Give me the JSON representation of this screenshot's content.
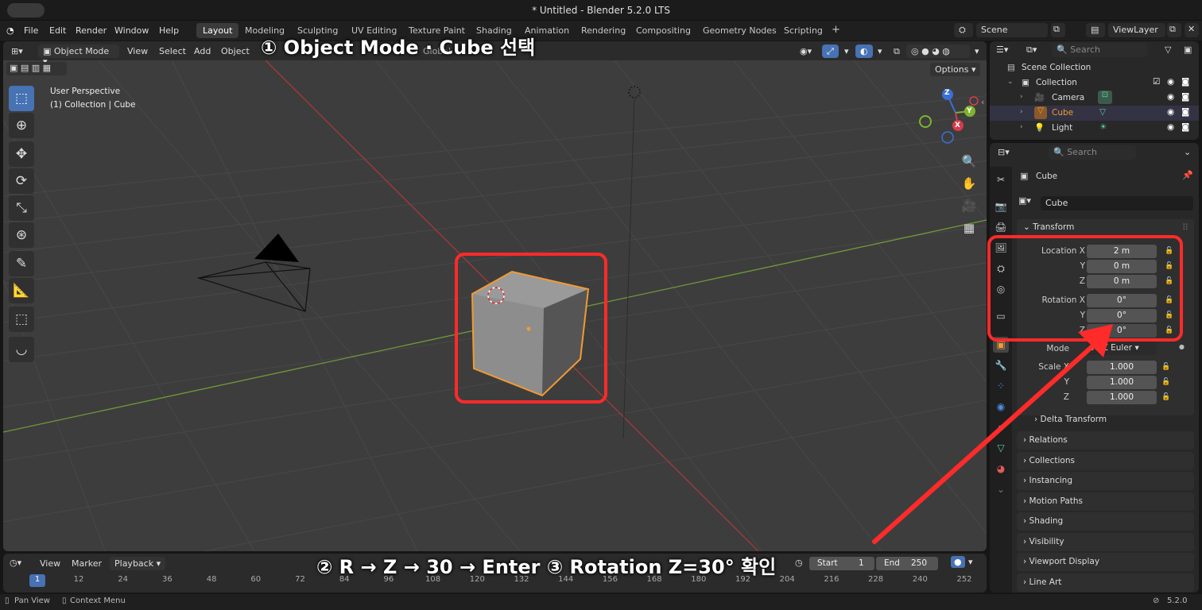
{
  "window": {
    "title": "* Untitled - Blender 5.2.0 LTS"
  },
  "menu": {
    "items": [
      "File",
      "Edit",
      "Render",
      "Window",
      "Help"
    ]
  },
  "workspaces": {
    "tabs": [
      "Layout",
      "Modeling",
      "Sculpting",
      "UV Editing",
      "Texture Paint",
      "Shading",
      "Animation",
      "Rendering",
      "Compositing",
      "Geometry Nodes",
      "Scripting"
    ],
    "active": "Layout",
    "add": "+"
  },
  "scene": {
    "name": "Scene",
    "view_layer": "ViewLayer"
  },
  "viewport": {
    "mode": "Object Mode",
    "menu": [
      "View",
      "Select",
      "Add",
      "Object"
    ],
    "orientation": "Global",
    "options_label": "Options",
    "overlay_line1": "User Perspective",
    "overlay_line2": "(1) Collection | Cube",
    "gizmo": {
      "x": "X",
      "y": "Y",
      "z": "Z"
    }
  },
  "outliner": {
    "search_placeholder": "Search",
    "root": "Scene Collection",
    "collection": "Collection",
    "items": [
      "Camera",
      "Cube",
      "Light"
    ]
  },
  "properties": {
    "search_placeholder": "Search",
    "object_name": "Cube",
    "object_field": "Cube",
    "transform_header": "Transform",
    "location_label": "Location X",
    "rotation_label": "Rotation X",
    "y_label": "Y",
    "z_label": "Z",
    "location": [
      "2 m",
      "0 m",
      "0 m"
    ],
    "rotation": [
      "0°",
      "0°",
      "0°"
    ],
    "mode_label": "Mode",
    "mode_value": "XYZ Euler",
    "scale_label": "Scale X",
    "scale": [
      "1.000",
      "1.000",
      "1.000"
    ],
    "delta": "Delta Transform",
    "sections": [
      "Relations",
      "Collections",
      "Instancing",
      "Motion Paths",
      "Shading",
      "Visibility",
      "Viewport Display",
      "Line Art"
    ]
  },
  "timeline": {
    "menu": [
      "View",
      "Marker",
      "Playback"
    ],
    "start_label": "Start",
    "start": "1",
    "end_label": "End",
    "end": "250",
    "current_frame": "1",
    "frames": [
      "12",
      "24",
      "36",
      "48",
      "60",
      "72",
      "84",
      "96",
      "108",
      "120",
      "132",
      "144",
      "156",
      "168",
      "180",
      "192",
      "204",
      "216",
      "228",
      "240",
      "252"
    ]
  },
  "status": {
    "left1": "Pan View",
    "left2": "Context Menu",
    "version": "5.2.0"
  },
  "annotations": {
    "step1": "① Object Mode · Cube 선택",
    "step2": "② R → Z → 30 → Enter  ③ Rotation Z=30° 확인"
  },
  "colors": {
    "accent": "#4772b3",
    "highlight": "#ff2a2a",
    "selected": "#f39a32"
  }
}
